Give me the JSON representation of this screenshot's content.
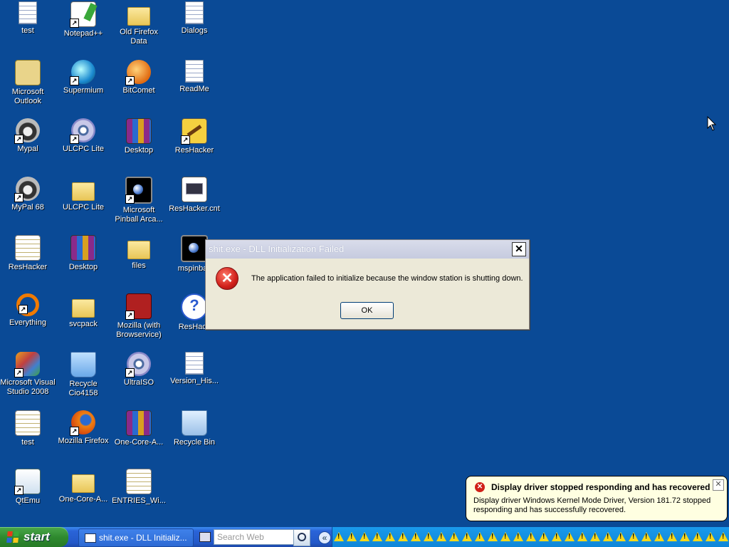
{
  "desktop": {
    "icons": [
      {
        "label": "test",
        "kind": "doc",
        "shortcut": false
      },
      {
        "label": "Notepad++",
        "kind": "np",
        "shortcut": true
      },
      {
        "label": "Old Firefox Data",
        "kind": "folder",
        "shortcut": false
      },
      {
        "label": "Dialogs",
        "kind": "doc",
        "shortcut": false
      },
      {
        "label": "Microsoft Outlook",
        "kind": "outlook",
        "shortcut": false
      },
      {
        "label": "Supermium",
        "kind": "globe",
        "shortcut": true
      },
      {
        "label": "BitComet",
        "kind": "bitcomet",
        "shortcut": true
      },
      {
        "label": "ReadMe",
        "kind": "doc",
        "shortcut": false
      },
      {
        "label": "Mypal",
        "kind": "raccoon",
        "shortcut": true
      },
      {
        "label": "ULCPC Lite",
        "kind": "cd",
        "shortcut": true
      },
      {
        "label": "Desktop",
        "kind": "rar",
        "shortcut": false
      },
      {
        "label": "ResHacker",
        "kind": "hammer",
        "shortcut": true
      },
      {
        "label": "MyPal 68",
        "kind": "raccoon",
        "shortcut": true
      },
      {
        "label": "ULCPC Lite",
        "kind": "folder",
        "shortcut": false
      },
      {
        "label": "Microsoft Pinball Arca...",
        "kind": "pinball",
        "shortcut": true
      },
      {
        "label": "ResHacker.cnt",
        "kind": "cnt",
        "shortcut": false
      },
      {
        "label": "ResHacker",
        "kind": "entries",
        "shortcut": false
      },
      {
        "label": "Desktop",
        "kind": "rar",
        "shortcut": false
      },
      {
        "label": "files",
        "kind": "folder",
        "shortcut": false
      },
      {
        "label": "mspinball",
        "kind": "pinball",
        "shortcut": false
      },
      {
        "label": "Everything",
        "kind": "everything",
        "shortcut": true
      },
      {
        "label": "svcpack",
        "kind": "folder",
        "shortcut": false
      },
      {
        "label": "Mozilla (with Browservice)",
        "kind": "mozilla",
        "shortcut": true
      },
      {
        "label": "ResHack",
        "kind": "help",
        "shortcut": false
      },
      {
        "label": "Microsoft Visual Studio 2008",
        "kind": "vs",
        "shortcut": true
      },
      {
        "label": "Recycle Cio4158",
        "kind": "recycle",
        "shortcut": false
      },
      {
        "label": "UltraISO",
        "kind": "cd",
        "shortcut": true
      },
      {
        "label": "Version_His...",
        "kind": "doc",
        "shortcut": false
      },
      {
        "label": "test",
        "kind": "entries",
        "shortcut": false
      },
      {
        "label": "Mozilla Firefox",
        "kind": "ff",
        "shortcut": true
      },
      {
        "label": "One-Core-A...",
        "kind": "rar",
        "shortcut": false
      },
      {
        "label": "Recycle Bin",
        "kind": "recyclebin",
        "shortcut": false
      },
      {
        "label": "QtEmu",
        "kind": "qtemu",
        "shortcut": true
      },
      {
        "label": "One-Core-A...",
        "kind": "folder",
        "shortcut": false
      },
      {
        "label": "ENTRIES_Wi...",
        "kind": "entries",
        "shortcut": false
      }
    ]
  },
  "dialog": {
    "title": "shit.exe - DLL Initialization Failed",
    "close_glyph": "✕",
    "icon": "error-icon",
    "icon_glyph": "✕",
    "message": "The application failed to initialize because the window station is shutting down.",
    "ok_label": "OK"
  },
  "balloon": {
    "icon": "error-icon",
    "icon_glyph": "✕",
    "title": "Display driver stopped responding and has recovered",
    "close_glyph": "✕",
    "text": "Display driver Windows Kernel Mode Driver, Version 181.72 stopped responding and has successfully recovered."
  },
  "taskbar": {
    "start_label": "start",
    "task_button_label": "shit.exe - DLL Initializ...",
    "search_placeholder": "Search Web",
    "tray_chevron": "«",
    "tray_warning_count": 36
  },
  "colors": {
    "desktop_bg": "#0a4a96",
    "dialog_bg": "#ece9d8",
    "balloon_bg": "#ffffe1",
    "error_red": "#d0201a"
  }
}
